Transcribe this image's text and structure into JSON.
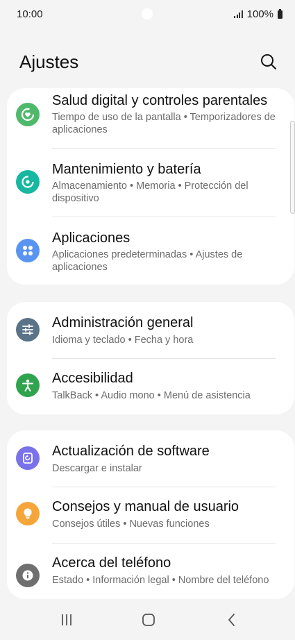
{
  "status_bar": {
    "time": "10:00",
    "battery": "100%"
  },
  "header": {
    "title": "Ajustes"
  },
  "groups": [
    {
      "items": [
        {
          "title": "Salud digital y controles parentales",
          "subtitle": "Tiempo de uso de la pantalla  •  Temporizadores de aplicaciones",
          "icon": "digital-wellbeing-icon",
          "color": "#4fb86a"
        },
        {
          "title": "Mantenimiento y batería",
          "subtitle": "Almacenamiento  •  Memoria  •  Protección del dispositivo",
          "icon": "device-care-icon",
          "color": "#17b7a2"
        },
        {
          "title": "Aplicaciones",
          "subtitle": "Aplicaciones predeterminadas  •  Ajustes de aplicaciones",
          "icon": "apps-icon",
          "color": "#5a94f2"
        }
      ]
    },
    {
      "items": [
        {
          "title": "Administración general",
          "subtitle": "Idioma y teclado  •  Fecha y hora",
          "icon": "sliders-icon",
          "color": "#5a7388"
        },
        {
          "title": "Accesibilidad",
          "subtitle": "TalkBack  •  Audio mono  •  Menú de asistencia",
          "icon": "accessibility-icon",
          "color": "#2fa34d"
        }
      ]
    },
    {
      "items": [
        {
          "title": "Actualización de software",
          "subtitle": "Descargar e instalar",
          "icon": "software-update-icon",
          "color": "#7a72ea"
        },
        {
          "title": "Consejos y manual de usuario",
          "subtitle": "Consejos útiles  •  Nuevas funciones",
          "icon": "lightbulb-icon",
          "color": "#f5a53a"
        },
        {
          "title": "Acerca del teléfono",
          "subtitle": "Estado  •  Información legal  •  Nombre del teléfono",
          "icon": "info-icon",
          "color": "#6f6f6f"
        }
      ]
    }
  ],
  "nav": {
    "recents": "recents-icon",
    "home": "home-icon",
    "back": "back-icon"
  }
}
